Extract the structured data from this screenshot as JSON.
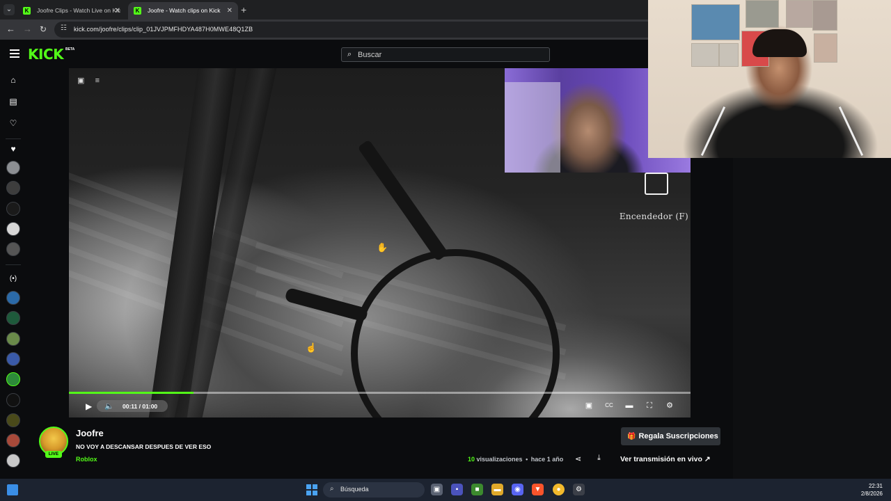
{
  "browser": {
    "tabs": [
      {
        "title": "Joofre Clips - Watch Live on Kic",
        "active": false
      },
      {
        "title": "Joofre - Watch clips on Kick",
        "active": true
      }
    ],
    "url": "kick.com/joofre/clips/clip_01JVJPMFHDYA487H0MWE48Q1ZB"
  },
  "header": {
    "logo": "KICK",
    "logo_badge": "BETA",
    "search_placeholder": "Buscar"
  },
  "player": {
    "overlay_text": "Encendedor (F)",
    "time_current": "00:11",
    "time_separator": "/",
    "time_total": "01:00",
    "progress_fraction": 0.2
  },
  "channel": {
    "name": "Joofre",
    "live_badge": "LIVE",
    "clip_title": "NO VOY A DESCANSAR DESPUES DE VER ESO",
    "category": "Roblox",
    "views_count": "10",
    "views_label": "visualizaciones",
    "dot": "•",
    "age": "hace 1 año",
    "gift_button": "Regala Suscripciones",
    "watch_live_button": "Ver transmisión en vivo"
  },
  "taskbar": {
    "search_label": "Búsqueda",
    "time": "22:31",
    "date": "2/8/2026"
  },
  "colors": {
    "brand_green": "#53fc18",
    "background": "#0b0c0e"
  }
}
